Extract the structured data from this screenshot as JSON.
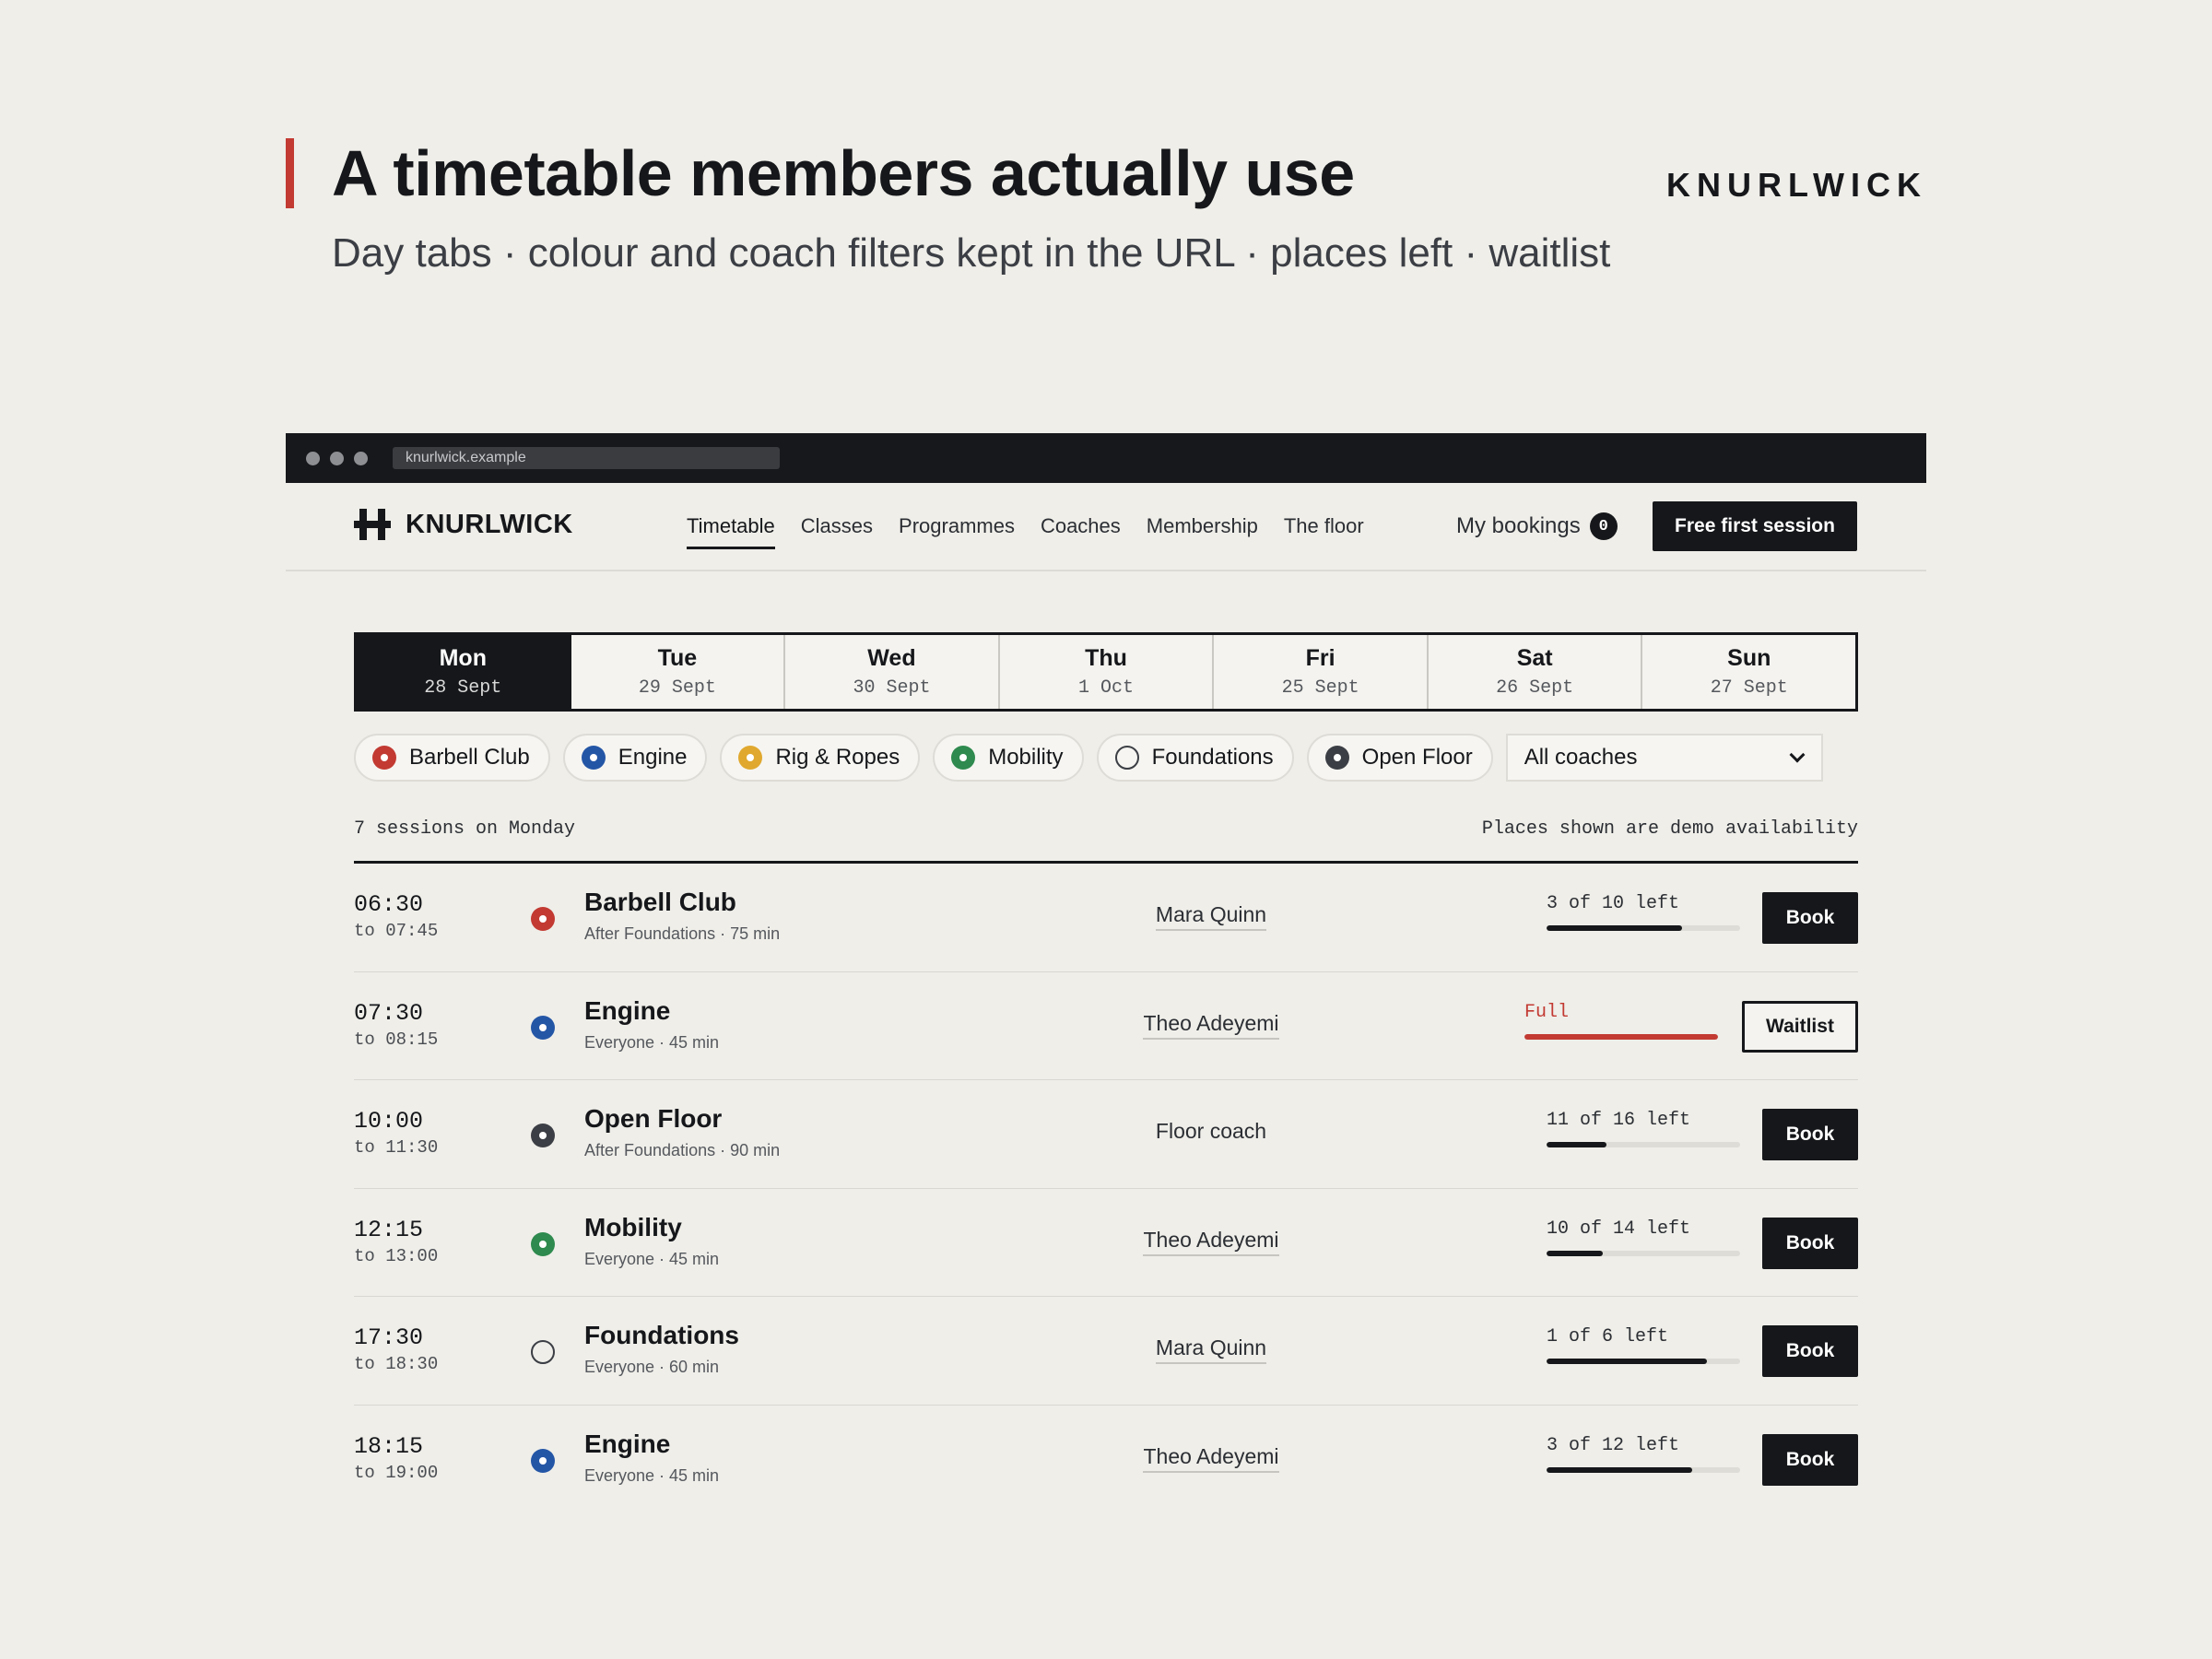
{
  "slide": {
    "title": "A timetable members actually use",
    "subtitle": "Day tabs · colour and coach filters kept in the URL · places left · waitlist",
    "brand": "KNURLWICK"
  },
  "browser": {
    "url": "knurlwick.example"
  },
  "header": {
    "logo_text": "KNURLWICK",
    "nav": [
      "Timetable",
      "Classes",
      "Programmes",
      "Coaches",
      "Membership",
      "The floor"
    ],
    "active_nav": "Timetable",
    "my_bookings_label": "My bookings",
    "my_bookings_count": "0",
    "cta_label": "Free first session"
  },
  "days": [
    {
      "name": "Mon",
      "date": "28 Sept",
      "active": true
    },
    {
      "name": "Tue",
      "date": "29 Sept"
    },
    {
      "name": "Wed",
      "date": "30 Sept"
    },
    {
      "name": "Thu",
      "date": "1 Oct"
    },
    {
      "name": "Fri",
      "date": "25 Sept"
    },
    {
      "name": "Sat",
      "date": "26 Sept"
    },
    {
      "name": "Sun",
      "date": "27 Sept"
    }
  ],
  "filters": [
    {
      "label": "Barbell Club",
      "color": "#c23a32"
    },
    {
      "label": "Engine",
      "color": "#2456a6"
    },
    {
      "label": "Rig & Ropes",
      "color": "#e0a82e"
    },
    {
      "label": "Mobility",
      "color": "#2e8a4e"
    },
    {
      "label": "Foundations",
      "color": "ring"
    },
    {
      "label": "Open Floor",
      "color": "#3b3e44"
    }
  ],
  "coach_select": {
    "value": "All coaches"
  },
  "list": {
    "count_text": "7 sessions on Monday",
    "note": "Places shown are demo availability"
  },
  "sessions": [
    {
      "start": "06:30",
      "end": "to 07:45",
      "class": "Barbell Club",
      "meta": "After Foundations · 75 min",
      "color": "#c23a32",
      "coach": "Mara Quinn",
      "coach_link": true,
      "avail": "3 of 10 left",
      "filled_fraction": 0.7,
      "full": false,
      "action": "Book"
    },
    {
      "start": "07:30",
      "end": "to 08:15",
      "class": "Engine",
      "meta": "Everyone · 45 min",
      "color": "#2456a6",
      "coach": "Theo Adeyemi",
      "coach_link": true,
      "avail": "Full",
      "filled_fraction": 1.0,
      "full": true,
      "action": "Waitlist"
    },
    {
      "start": "10:00",
      "end": "to 11:30",
      "class": "Open Floor",
      "meta": "After Foundations · 90 min",
      "color": "#3b3e44",
      "coach": "Floor coach",
      "coach_link": false,
      "avail": "11 of 16 left",
      "filled_fraction": 0.31,
      "full": false,
      "action": "Book"
    },
    {
      "start": "12:15",
      "end": "to 13:00",
      "class": "Mobility",
      "meta": "Everyone · 45 min",
      "color": "#2e8a4e",
      "coach": "Theo Adeyemi",
      "coach_link": true,
      "avail": "10 of 14 left",
      "filled_fraction": 0.29,
      "full": false,
      "action": "Book"
    },
    {
      "start": "17:30",
      "end": "to 18:30",
      "class": "Foundations",
      "meta": "Everyone · 60 min",
      "color": "ring",
      "coach": "Mara Quinn",
      "coach_link": true,
      "avail": "1 of 6 left",
      "filled_fraction": 0.83,
      "full": false,
      "action": "Book"
    },
    {
      "start": "18:15",
      "end": "to 19:00",
      "class": "Engine",
      "meta": "Everyone · 45 min",
      "color": "#2456a6",
      "coach": "Theo Adeyemi",
      "coach_link": true,
      "avail": "3 of 12 left",
      "filled_fraction": 0.75,
      "full": false,
      "action": "Book"
    }
  ]
}
